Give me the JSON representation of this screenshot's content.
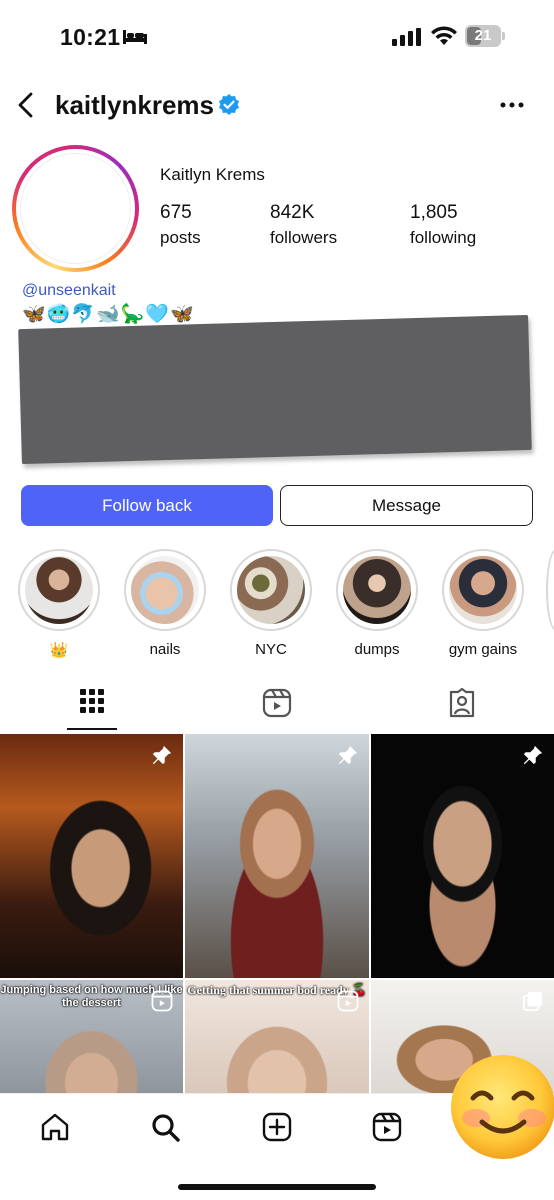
{
  "status_bar": {
    "time": "10:21",
    "battery": "21"
  },
  "header": {
    "username": "kaitlynkrems"
  },
  "profile": {
    "display_name": "Kaitlyn Krems",
    "stats": [
      {
        "value": "675",
        "label": "posts"
      },
      {
        "value": "842K",
        "label": "followers"
      },
      {
        "value": "1,805",
        "label": "following"
      }
    ],
    "bio_handle": "@unseenkait",
    "bio_emoji": "🦋🥶🐬🐋🦕🩵🦋"
  },
  "actions": {
    "follow_back": "Follow back",
    "message": "Message"
  },
  "highlights": [
    {
      "label": "👑"
    },
    {
      "label": "nails"
    },
    {
      "label": "NYC"
    },
    {
      "label": "dumps"
    },
    {
      "label": "gym gains"
    }
  ],
  "grid": {
    "captions": {
      "post4": "Jumping based on how much I like the dessert",
      "post5": "Getting that summer bod ready 🍒"
    }
  },
  "colors": {
    "follow_button": "#4f63f6",
    "verified": "#1d9bf0",
    "link": "#3b5bbf"
  }
}
